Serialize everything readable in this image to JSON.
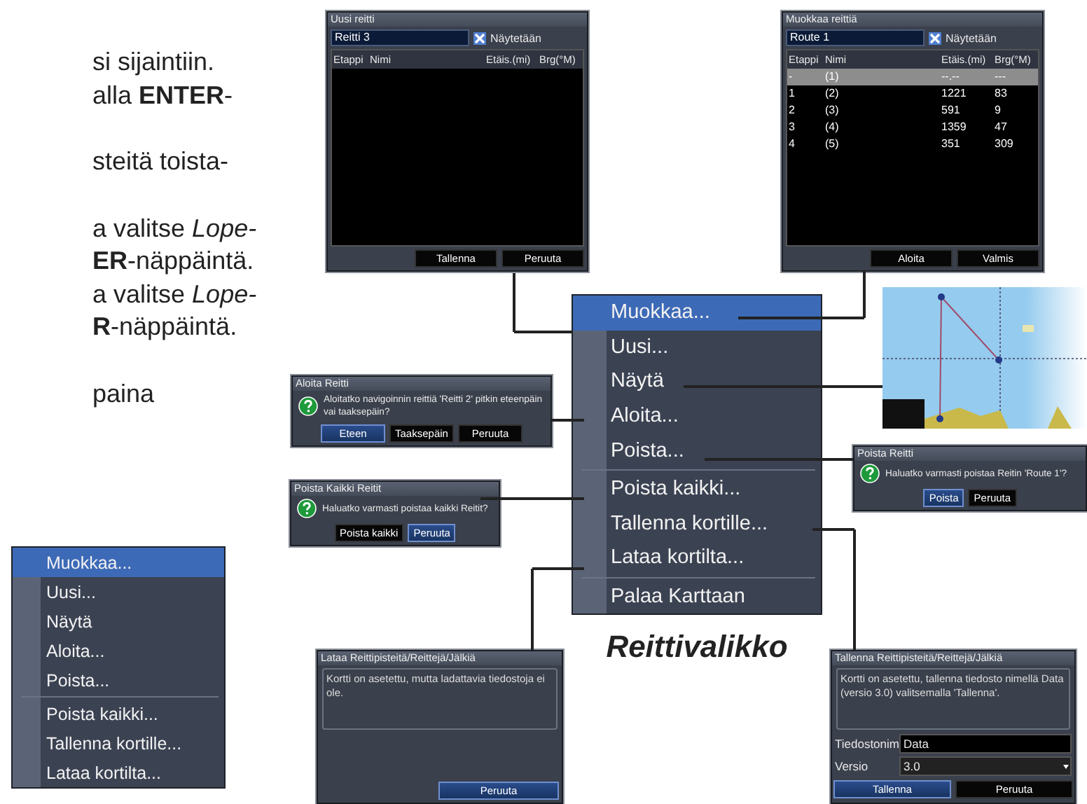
{
  "manual_text": {
    "paragraphs": [
      [
        "si sijaintiin.",
        "alla **ENTER**-"
      ],
      [
        "steitä toista-"
      ],
      [
        "a valitse *Lope-*",
        "**ER**-näppäintä.",
        "a valitse *Lope-*",
        "**R**-näppäintä."
      ],
      [
        "paina"
      ]
    ]
  },
  "side_menu": {
    "groups": [
      [
        {
          "label": "Muokkaa...",
          "selected": true
        },
        {
          "label": "Uusi...",
          "selected": false
        },
        {
          "label": "Näytä",
          "selected": false
        },
        {
          "label": "Aloita...",
          "selected": false
        },
        {
          "label": "Poista...",
          "selected": false
        }
      ],
      [
        {
          "label": "Poista kaikki...",
          "selected": false
        },
        {
          "label": "Tallenna kortille...",
          "selected": false
        },
        {
          "label": "Lataa kortilta...",
          "selected": false
        }
      ]
    ]
  },
  "figure": {
    "new_route": {
      "title": "Uusi reitti",
      "name_value": "Reitti 3",
      "show_label": "Näytetään",
      "show_checked": true,
      "columns": [
        "Etappi",
        "Nimi",
        "Etäis.(mi)",
        "Brg(°M)"
      ],
      "buttons": [
        {
          "label": "Tallenna",
          "selected": false
        },
        {
          "label": "Peruuta",
          "selected": false
        }
      ]
    },
    "edit_route": {
      "title": "Muokkaa reittiä",
      "name_value": "Route 1",
      "show_label": "Näytetään",
      "show_checked": true,
      "columns": [
        "Etappi",
        "Nimi",
        "Etäis.(mi)",
        "Brg(°M)"
      ],
      "rows": [
        {
          "cells": [
            "-",
            "(1)",
            "--.--",
            "---"
          ],
          "selected": true
        },
        {
          "cells": [
            "1",
            "(2)",
            "1221",
            "83"
          ],
          "selected": false
        },
        {
          "cells": [
            "2",
            "(3)",
            "591",
            "9"
          ],
          "selected": false
        },
        {
          "cells": [
            "3",
            "(4)",
            "1359",
            "47"
          ],
          "selected": false
        },
        {
          "cells": [
            "4",
            "(5)",
            "351",
            "309"
          ],
          "selected": false
        }
      ],
      "buttons": [
        {
          "label": "Aloita",
          "selected": false
        },
        {
          "label": "Valmis",
          "selected": false
        }
      ]
    },
    "route_menu": {
      "groups": [
        [
          {
            "label": "Muokkaa...",
            "selected": true
          },
          {
            "label": "Uusi...",
            "selected": false
          },
          {
            "label": "Näytä",
            "selected": false
          },
          {
            "label": "Aloita...",
            "selected": false
          },
          {
            "label": "Poista...",
            "selected": false
          }
        ],
        [
          {
            "label": "Poista kaikki...",
            "selected": false
          },
          {
            "label": "Tallenna kortille...",
            "selected": false
          },
          {
            "label": "Lataa kortilta...",
            "selected": false
          }
        ],
        [
          {
            "label": "Palaa Karttaan",
            "selected": false
          }
        ]
      ]
    },
    "caption": "Reittivalikko",
    "start_dialog": {
      "title": "Aloita Reitti",
      "message": "Aloitatko navigoinnin reittiä 'Reitti 2' pitkin eteenpäin vai taaksepäin?",
      "buttons": [
        {
          "label": "Eteen",
          "selected": true
        },
        {
          "label": "Taaksepäin",
          "selected": false
        },
        {
          "label": "Peruuta",
          "selected": false
        }
      ]
    },
    "delete_all_dialog": {
      "title": "Poista Kaikki Reitit",
      "message": "Haluatko varmasti poistaa kaikki Reitit?",
      "buttons": [
        {
          "label": "Poista kaikki",
          "selected": false
        },
        {
          "label": "Peruuta",
          "selected": true
        }
      ]
    },
    "delete_dialog": {
      "title": "Poista Reitti",
      "message": "Haluatko varmasti poistaa Reitin 'Route 1'?",
      "buttons": [
        {
          "label": "Poista",
          "selected": true
        },
        {
          "label": "Peruuta",
          "selected": false
        }
      ]
    },
    "load_dialog": {
      "title": "Lataa Reittipisteitä/Reittejä/Jälkiä",
      "message": "Kortti on asetettu, mutta ladattavia tiedostoja ei ole.",
      "buttons": [
        {
          "label": "Peruuta",
          "selected": true
        }
      ]
    },
    "save_dialog": {
      "title": "Tallenna Reittipisteitä/Reittejä/Jälkiä",
      "message": "Kortti on asetettu, tallenna tiedosto nimellä Data (versio 3.0) valitsemalla 'Tallenna'.",
      "fields": [
        {
          "kind": "text",
          "label": "Tiedostonim",
          "value": "Data"
        },
        {
          "kind": "dropdown",
          "label": "Versio",
          "value": "3.0"
        }
      ],
      "buttons": [
        {
          "label": "Tallenna",
          "selected": true
        },
        {
          "label": "Peruuta",
          "selected": false
        }
      ]
    }
  }
}
